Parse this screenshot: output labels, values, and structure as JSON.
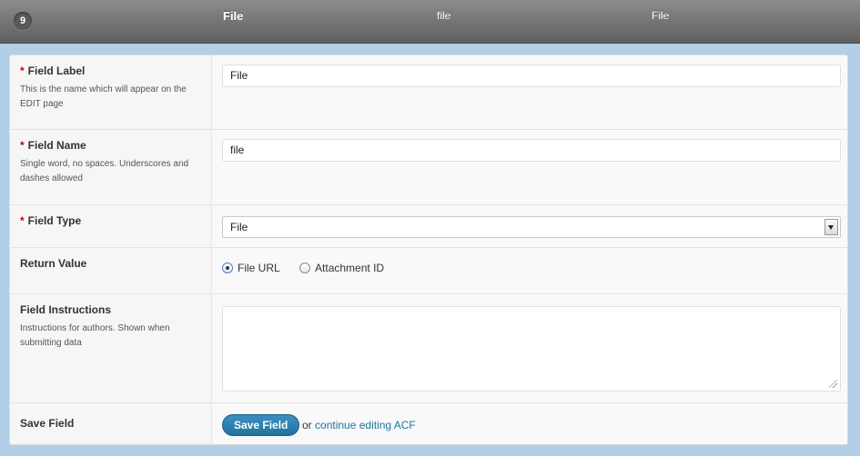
{
  "header": {
    "order": "9",
    "field_label": "File",
    "field_name": "file",
    "field_type": "File"
  },
  "rows": {
    "label": {
      "required": "*",
      "title": "Field Label",
      "desc": "This is the name which will appear on the EDIT page",
      "value": "File"
    },
    "name": {
      "required": "*",
      "title": "Field Name",
      "desc": "Single word, no spaces. Underscores and dashes allowed",
      "value": "file"
    },
    "type": {
      "required": "*",
      "title": "Field Type",
      "value": "File"
    },
    "return_value": {
      "title": "Return Value",
      "options": [
        "File URL",
        "Attachment ID"
      ],
      "selected": "File URL"
    },
    "instructions": {
      "title": "Field Instructions",
      "desc": "Instructions for authors. Shown when submitting data",
      "value": ""
    },
    "save": {
      "title": "Save Field",
      "button": "Save Field",
      "or": "or",
      "link": "continue editing ACF"
    }
  },
  "colors": {
    "accent": "#21759b",
    "required": "#cc0000",
    "background": "#b3cfe8"
  }
}
